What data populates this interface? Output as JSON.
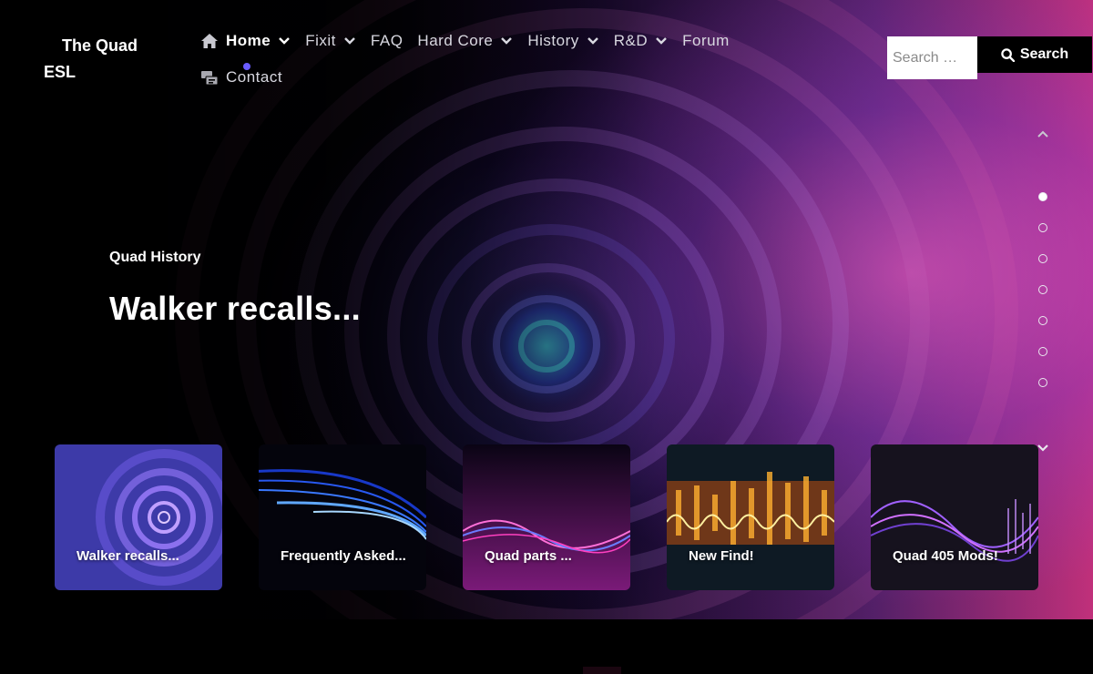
{
  "site": {
    "title_line1": "The Quad",
    "title_line2": "ESL"
  },
  "nav": {
    "items": [
      {
        "label": "Home",
        "icon": "home-icon",
        "dropdown": true,
        "active": true
      },
      {
        "label": "Fixit",
        "dropdown": true
      },
      {
        "label": "FAQ",
        "dropdown": false
      },
      {
        "label": "Hard Core",
        "dropdown": true
      },
      {
        "label": "History",
        "dropdown": true
      },
      {
        "label": "R&D",
        "dropdown": true
      },
      {
        "label": "Forum",
        "dropdown": false
      }
    ],
    "second_row": [
      {
        "label": "Contact",
        "icon": "contact-card-icon"
      }
    ]
  },
  "search": {
    "placeholder": "Search …",
    "button_label": "Search"
  },
  "slide": {
    "category": "Quad History",
    "title": "Walker recalls..."
  },
  "pager": {
    "dots": 7,
    "active_index": 0
  },
  "cards": [
    {
      "label": "Walker recalls..."
    },
    {
      "label": "Frequently Asked..."
    },
    {
      "label": "Quad parts ..."
    },
    {
      "label": "New Find!"
    },
    {
      "label": "Quad 405 Mods!"
    }
  ],
  "colors": {
    "accent_dot": "#6a5cff",
    "background": "#000000"
  }
}
